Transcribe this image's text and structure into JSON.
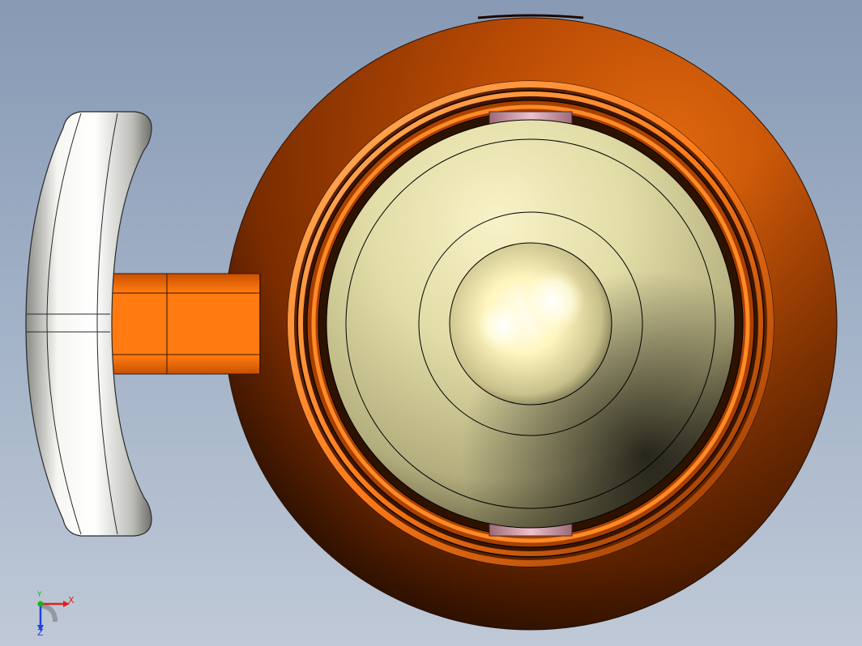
{
  "triad": {
    "x_label": "X",
    "y_label": "Y",
    "z_label": "Z",
    "x_color": "#e02020",
    "y_color": "#20b020",
    "z_color": "#2040e0"
  },
  "colors": {
    "background_top": "#8799b4",
    "background_bottom": "#bfc9d7",
    "body_orange": "#c85a08",
    "stem_orange": "#ff7a10",
    "ball_cream": "#efe8b0",
    "handwheel_grey": "#e6e6e2",
    "seat_pink": "#c98a9a"
  }
}
